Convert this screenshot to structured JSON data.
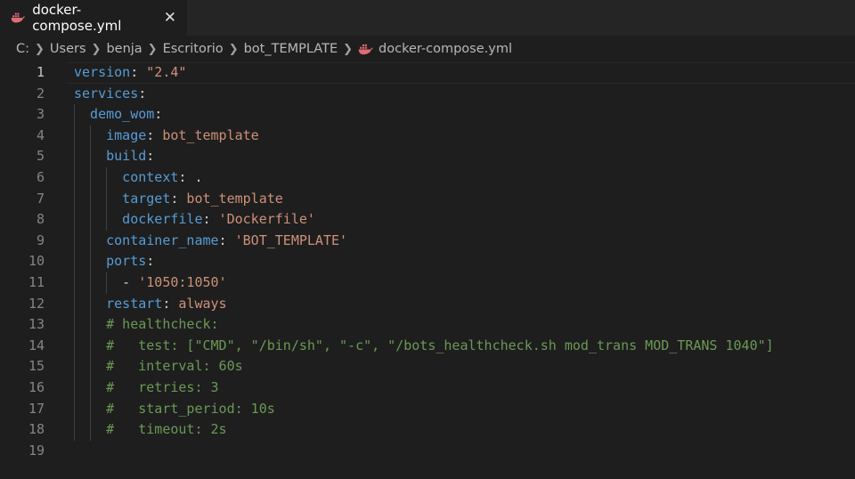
{
  "tab": {
    "title": "docker-compose.yml",
    "close": "✕"
  },
  "breadcrumb": [
    "C:",
    "Users",
    "benja",
    "Escritorio",
    "bot_TEMPLATE",
    "docker-compose.yml"
  ],
  "editor": {
    "current_line": 1,
    "lines": [
      {
        "n": "1",
        "key": "version",
        "sep": ": ",
        "val": "\"2.4\""
      },
      {
        "n": "2",
        "key": "services",
        "sep": ":"
      },
      {
        "n": "3",
        "key": "demo_wom",
        "sep": ":"
      },
      {
        "n": "4",
        "key": "image",
        "sep": ": ",
        "val": "bot_template"
      },
      {
        "n": "5",
        "key": "build",
        "sep": ":"
      },
      {
        "n": "6",
        "key": "context",
        "sep": ": ",
        "val": "."
      },
      {
        "n": "7",
        "key": "target",
        "sep": ": ",
        "val": "bot_template"
      },
      {
        "n": "8",
        "key": "dockerfile",
        "sep": ": ",
        "val": "'Dockerfile'"
      },
      {
        "n": "9",
        "key": "container_name",
        "sep": ": ",
        "val": "'BOT_TEMPLATE'"
      },
      {
        "n": "10",
        "key": "ports",
        "sep": ":"
      },
      {
        "n": "11",
        "dash": "- ",
        "val": "'1050:1050'"
      },
      {
        "n": "12",
        "key": "restart",
        "sep": ": ",
        "val": "always"
      },
      {
        "n": "13",
        "comment": "# healthcheck:"
      },
      {
        "n": "14",
        "comment": "#   test: [\"CMD\", \"/bin/sh\", \"-c\", \"/bots_healthcheck.sh mod_trans MOD_TRANS 1040\"]"
      },
      {
        "n": "15",
        "comment": "#   interval: 60s"
      },
      {
        "n": "16",
        "comment": "#   retries: 3"
      },
      {
        "n": "17",
        "comment": "#   start_period: 10s"
      },
      {
        "n": "18",
        "comment": "#   timeout: 2s"
      },
      {
        "n": "19"
      }
    ]
  },
  "colors": {
    "key": "#569cd6",
    "string": "#ce9178",
    "comment": "#6a9955",
    "punct": "#d4d4d4"
  }
}
